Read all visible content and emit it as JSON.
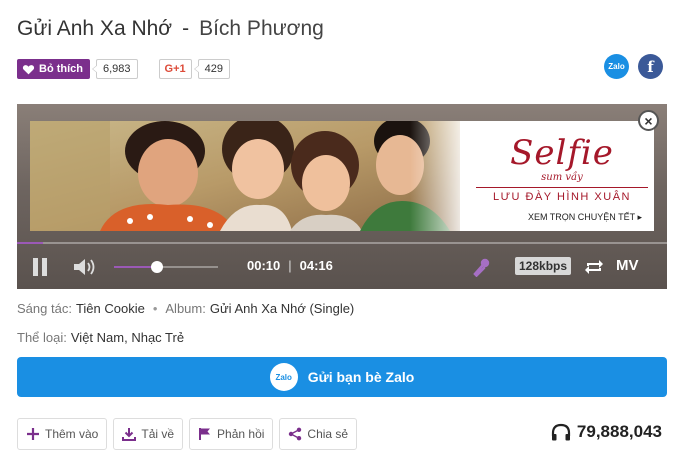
{
  "song": {
    "title": "Gửi Anh Xa Nhớ",
    "separator": "-",
    "artist": "Bích Phương"
  },
  "social": {
    "like_label": "Bỏ thích",
    "like_count": "6,983",
    "gplus_label": "G+1",
    "gplus_count": "429",
    "zalo_icon_label": "Zalo",
    "facebook_icon_label": "f"
  },
  "banner": {
    "headline": "Selfie",
    "subheadline": "sum vầy",
    "tagline": "LƯU ĐÀY HÌNH XUÂN",
    "cta": "XEM TRỌN CHUYỆN TẾT ▸",
    "close_symbol": "×"
  },
  "player": {
    "current_time": "00:10",
    "time_separator": "|",
    "duration": "04:16",
    "progress_fraction": 0.04,
    "volume_fraction": 0.41,
    "bitrate": "128kbps",
    "mv_label": "MV",
    "accent_color": "#9b59b6"
  },
  "meta": {
    "composer_label": "Sáng tác:",
    "composer": "Tiên Cookie",
    "album_label": "Album:",
    "album": "Gửi Anh Xa Nhớ (Single)",
    "genre_label": "Thể loại:",
    "genre": "Việt Nam, Nhạc Trẻ"
  },
  "zalo_share": {
    "badge": "Zalo",
    "label": "Gửi bạn bè Zalo",
    "color": "#1a8fe3"
  },
  "actions": {
    "add_label": "Thêm vào",
    "download_label": "Tải về",
    "feedback_label": "Phản hồi",
    "share_label": "Chia sẻ"
  },
  "listen_count": "79,888,043",
  "colors": {
    "brand_purple": "#7b2f8c",
    "banner_red": "#a5182a"
  }
}
